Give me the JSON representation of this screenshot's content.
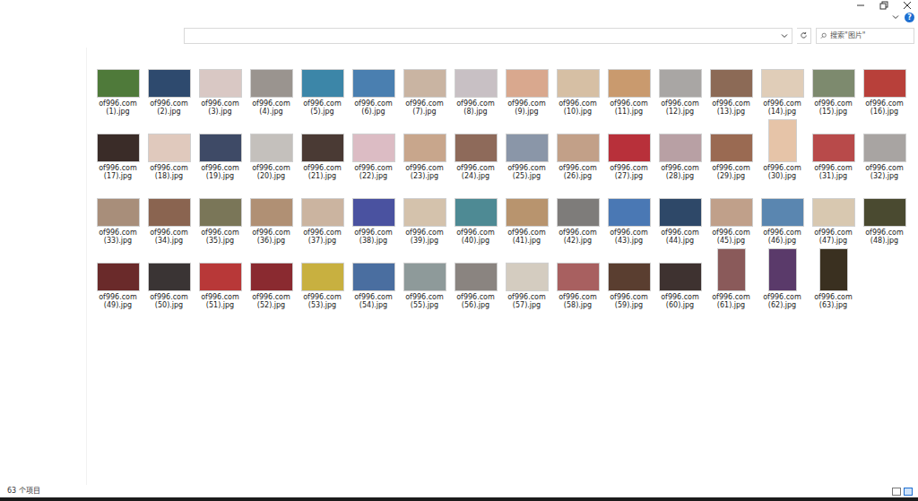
{
  "help": {
    "label": "?"
  },
  "search": {
    "placeholder": "搜索\"图片\""
  },
  "status_bar": {
    "item_count": "63 个项目"
  },
  "files": [
    {
      "name": "of996.com (1).jpg",
      "kind": "landscape",
      "color": "#4f7a3a"
    },
    {
      "name": "of996.com (2).jpg",
      "kind": "landscape",
      "color": "#2e4a6e"
    },
    {
      "name": "of996.com (3).jpg",
      "kind": "landscape",
      "color": "#d9c8c4"
    },
    {
      "name": "of996.com (4).jpg",
      "kind": "landscape",
      "color": "#9a948f"
    },
    {
      "name": "of996.com (5).jpg",
      "kind": "landscape",
      "color": "#3c86a8"
    },
    {
      "name": "of996.com (6).jpg",
      "kind": "landscape",
      "color": "#4a7fb0"
    },
    {
      "name": "of996.com (7).jpg",
      "kind": "landscape",
      "color": "#c9b4a2"
    },
    {
      "name": "of996.com (8).jpg",
      "kind": "landscape",
      "color": "#c8c0c4"
    },
    {
      "name": "of996.com (9).jpg",
      "kind": "landscape",
      "color": "#d9a88e"
    },
    {
      "name": "of996.com (10).jpg",
      "kind": "landscape",
      "color": "#d6bfa4"
    },
    {
      "name": "of996.com (11).jpg",
      "kind": "landscape",
      "color": "#c99a6e"
    },
    {
      "name": "of996.com (12).jpg",
      "kind": "landscape",
      "color": "#a9a6a4"
    },
    {
      "name": "of996.com (13).jpg",
      "kind": "landscape",
      "color": "#8c6a56"
    },
    {
      "name": "of996.com (14).jpg",
      "kind": "landscape",
      "color": "#e0cdb8"
    },
    {
      "name": "of996.com (15).jpg",
      "kind": "landscape",
      "color": "#7d8a6e"
    },
    {
      "name": "of996.com (16).jpg",
      "kind": "landscape",
      "color": "#b8403a"
    },
    {
      "name": "of996.com (17).jpg",
      "kind": "landscape",
      "color": "#3a2c28"
    },
    {
      "name": "of996.com (18).jpg",
      "kind": "landscape",
      "color": "#e0c9bd"
    },
    {
      "name": "of996.com (19).jpg",
      "kind": "landscape",
      "color": "#3e4a66"
    },
    {
      "name": "of996.com (20).jpg",
      "kind": "landscape",
      "color": "#c4c0bc"
    },
    {
      "name": "of996.com (21).jpg",
      "kind": "landscape",
      "color": "#4a3a34"
    },
    {
      "name": "of996.com (22).jpg",
      "kind": "landscape",
      "color": "#dcbcc4"
    },
    {
      "name": "of996.com (23).jpg",
      "kind": "landscape",
      "color": "#c8a68c"
    },
    {
      "name": "of996.com (24).jpg",
      "kind": "landscape",
      "color": "#8e6a5a"
    },
    {
      "name": "of996.com (25).jpg",
      "kind": "landscape",
      "color": "#8a96a8"
    },
    {
      "name": "of996.com (26).jpg",
      "kind": "landscape",
      "color": "#c2a088"
    },
    {
      "name": "of996.com (27).jpg",
      "kind": "landscape",
      "color": "#b8303a"
    },
    {
      "name": "of996.com (28).jpg",
      "kind": "landscape",
      "color": "#b8a0a4"
    },
    {
      "name": "of996.com (29).jpg",
      "kind": "landscape",
      "color": "#9a6a52"
    },
    {
      "name": "of996.com (30).jpg",
      "kind": "portrait",
      "color": "#e6c4a8"
    },
    {
      "name": "of996.com (31).jpg",
      "kind": "landscape",
      "color": "#b84a4a"
    },
    {
      "name": "of996.com (32).jpg",
      "kind": "landscape",
      "color": "#a8a4a2"
    },
    {
      "name": "of996.com (33).jpg",
      "kind": "landscape",
      "color": "#a88e7a"
    },
    {
      "name": "of996.com (34).jpg",
      "kind": "landscape",
      "color": "#8a6450"
    },
    {
      "name": "of996.com (35).jpg",
      "kind": "landscape",
      "color": "#7a7658"
    },
    {
      "name": "of996.com (36).jpg",
      "kind": "landscape",
      "color": "#b09074"
    },
    {
      "name": "of996.com (37).jpg",
      "kind": "landscape",
      "color": "#cbb4a0"
    },
    {
      "name": "of996.com (38).jpg",
      "kind": "landscape",
      "color": "#4a52a0"
    },
    {
      "name": "of996.com (39).jpg",
      "kind": "landscape",
      "color": "#d4c2ac"
    },
    {
      "name": "of996.com (40).jpg",
      "kind": "landscape",
      "color": "#4e8a94"
    },
    {
      "name": "of996.com (41).jpg",
      "kind": "landscape",
      "color": "#b8946e"
    },
    {
      "name": "of996.com (42).jpg",
      "kind": "landscape",
      "color": "#7e7c7a"
    },
    {
      "name": "of996.com (43).jpg",
      "kind": "landscape",
      "color": "#4a78b4"
    },
    {
      "name": "of996.com (44).jpg",
      "kind": "landscape",
      "color": "#2e4868"
    },
    {
      "name": "of996.com (45).jpg",
      "kind": "landscape",
      "color": "#c0a08a"
    },
    {
      "name": "of996.com (46).jpg",
      "kind": "landscape",
      "color": "#5a86b0"
    },
    {
      "name": "of996.com (47).jpg",
      "kind": "landscape",
      "color": "#d8c8b0"
    },
    {
      "name": "of996.com (48).jpg",
      "kind": "landscape",
      "color": "#4a4a30"
    },
    {
      "name": "of996.com (49).jpg",
      "kind": "landscape",
      "color": "#6a2a2a"
    },
    {
      "name": "of996.com (50).jpg",
      "kind": "landscape",
      "color": "#3a3434"
    },
    {
      "name": "of996.com (51).jpg",
      "kind": "landscape",
      "color": "#b83838"
    },
    {
      "name": "of996.com (52).jpg",
      "kind": "landscape",
      "color": "#8a2a30"
    },
    {
      "name": "of996.com (53).jpg",
      "kind": "landscape",
      "color": "#c8b040"
    },
    {
      "name": "of996.com (54).jpg",
      "kind": "landscape",
      "color": "#4a6ea0"
    },
    {
      "name": "of996.com (55).jpg",
      "kind": "landscape",
      "color": "#8e9a9a"
    },
    {
      "name": "of996.com (56).jpg",
      "kind": "landscape",
      "color": "#8a8480"
    },
    {
      "name": "of996.com (57).jpg",
      "kind": "landscape",
      "color": "#d4ccc0"
    },
    {
      "name": "of996.com (58).jpg",
      "kind": "landscape",
      "color": "#a86060"
    },
    {
      "name": "of996.com (59).jpg",
      "kind": "landscape",
      "color": "#5a3e30"
    },
    {
      "name": "of996.com (60).jpg",
      "kind": "landscape",
      "color": "#3e3230"
    },
    {
      "name": "of996.com (61).jpg",
      "kind": "portrait",
      "color": "#8a5a5a"
    },
    {
      "name": "of996.com (62).jpg",
      "kind": "portrait",
      "color": "#5a3a6a"
    },
    {
      "name": "of996.com (63).jpg",
      "kind": "portrait",
      "color": "#3a3020"
    }
  ]
}
